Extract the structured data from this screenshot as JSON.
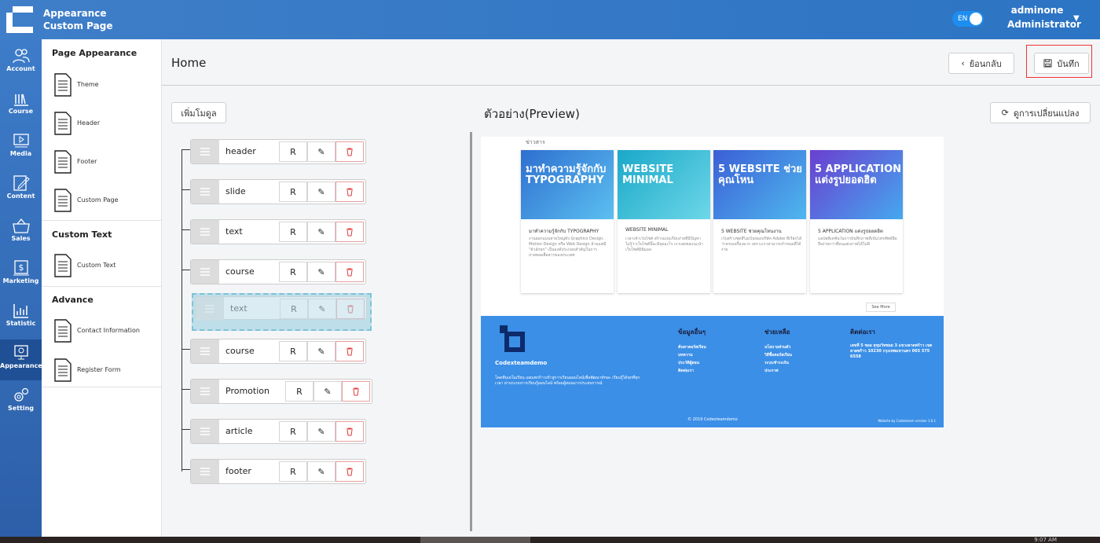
{
  "app": {
    "title_line1": "Appearance",
    "title_line2": "Custom Page",
    "lang": "EN",
    "user_name": "adminone",
    "user_role": "Administrator"
  },
  "rail": [
    {
      "label": "Account",
      "icon": "users-icon"
    },
    {
      "label": "Course",
      "icon": "library-icon"
    },
    {
      "label": "Media",
      "icon": "media-icon"
    },
    {
      "label": "Content",
      "icon": "edit-icon"
    },
    {
      "label": "Sales",
      "icon": "basket-icon"
    },
    {
      "label": "Marketing",
      "icon": "dollar-icon"
    },
    {
      "label": "Statistic",
      "icon": "chart-icon"
    },
    {
      "label": "Appearance",
      "icon": "monitor-icon",
      "active": true
    },
    {
      "label": "Setting",
      "icon": "gears-icon"
    }
  ],
  "panel": {
    "page_appearance": "Page Appearance",
    "theme": "Theme",
    "header": "Header",
    "footer": "Footer",
    "custom_page": "Custom Page",
    "custom_text_title": "Custom Text",
    "custom_text": "Custom Text",
    "advance": "Advance",
    "contact": "Contact Information",
    "register": "Register Form"
  },
  "main": {
    "title": "Home",
    "back": "ย้อนกลับ",
    "save": "บันทึก",
    "add_module": "เพิ่มโมดูล",
    "preview_title": "ตัวอย่าง(Preview)",
    "view_changes": "ดูการเปลี่ยนแปลง"
  },
  "modules": [
    {
      "name": "header",
      "r": "R"
    },
    {
      "name": "slide",
      "r": "R"
    },
    {
      "name": "text",
      "r": "R"
    },
    {
      "name": "course",
      "r": "R"
    },
    {
      "name": "course",
      "r": "R"
    },
    {
      "name": "Promotion",
      "r": "R"
    },
    {
      "name": "article",
      "r": "R"
    },
    {
      "name": "footer",
      "r": "R"
    }
  ],
  "dragging": {
    "name": "text",
    "r": "R"
  },
  "preview": {
    "news_label": "ข่าวสาร",
    "cards": [
      {
        "img_text": "มาทำความรู้จักกับ TYPOGRAPHY",
        "title": "มาทำความรู้จักกับ TYPOGRAPHY",
        "desc": "งานออกแบบสายใหญ่ทั้ง Graphics Design, Motion Design หรือ Web Design ล้วนแต่มี \"ตัวอักษร\" เป็นองค์ประกอบสำคัญในการถ่ายทอดสื่อสารของประเทศ",
        "color1": "#2e6fd0",
        "color2": "#5cc0f0"
      },
      {
        "img_text": "WEBSITE MINIMAL",
        "title": "WEBSITE MINIMAL",
        "desc": "เวลาเข้าเว็บไซต์ สร้างแบบเรียบง่ายที่มีปัญหา ไม่รู้ว่าเว็บไซต์นี้จะมีจุดอะไร เราเลยขอแนะนำเว็บไซต์มินิมอล",
        "color1": "#1aa8c9",
        "color2": "#6ed7e8"
      },
      {
        "img_text": "5 WEBSITE ช่วยคุณโหน",
        "title": "5 WEBSITE ช่วยคุณโหนงาน",
        "desc": "เว็บสร้างชุดสีไม่เป็นของบริษัท Adobe ที่เรียกได้ว่าครบเครื่องมาก เพราะเราสามารถกำหนดสีได้ง่าย",
        "color1": "#3b5fd6",
        "color2": "#4fb7ee"
      },
      {
        "img_text": "5 APPLICATION แต่งรูปยอดฮิต",
        "title": "5 APPLICATION แต่งรูปยอดฮิต",
        "desc": "แอปพลิเคชันในการบันทึกภาพที่เป็นโทรศัพท์มือถือง่ายกว่าที่คนแต่งภาพได้ไม่ดี",
        "color1": "#6a3fd0",
        "color2": "#45a8ef"
      }
    ],
    "see_more": "See More",
    "footer": {
      "brand": "Codexteamdemo",
      "desc": "โคดทีมเดโมเรียน เผยแพร่ก้าวเข้าสู่การเรียนออนไลน์เพื่อพัฒนาทักษะ เรียนรู้ได้ทุกที่ทุกเวลา ผ่านระบบการเรียนรู้ออนไลน์ พร้อมผู้สอนมากประสบการณ์",
      "col1_title": "ข้อมูลอื่นๆ",
      "col1": [
        "ค้นหาคอร์สเรียน",
        "บทความ",
        "ประวัติผู้สอน",
        "ติดต่อเรา"
      ],
      "col2_title": "ช่วยเหลือ",
      "col2": [
        "นโยบายส่วนตัว",
        "วิธีซื้อคอร์สเรียน",
        "ระบบชำระเงิน",
        "ประกาศ"
      ],
      "col3_title": "ติดต่อเรา",
      "address": "เลขที่ 5 ซอย สุขุมวิทซอย 3 แขวงลาดพร้าว เขตลาดพร้าว 10230 กรุงเทพมหานคร 065 575 6558",
      "copyright": "© 2019 Codexteamdemo",
      "credit": "Website by Codexteam version 1.0.1"
    }
  },
  "taskbar": {
    "time": "9:07 AM"
  }
}
